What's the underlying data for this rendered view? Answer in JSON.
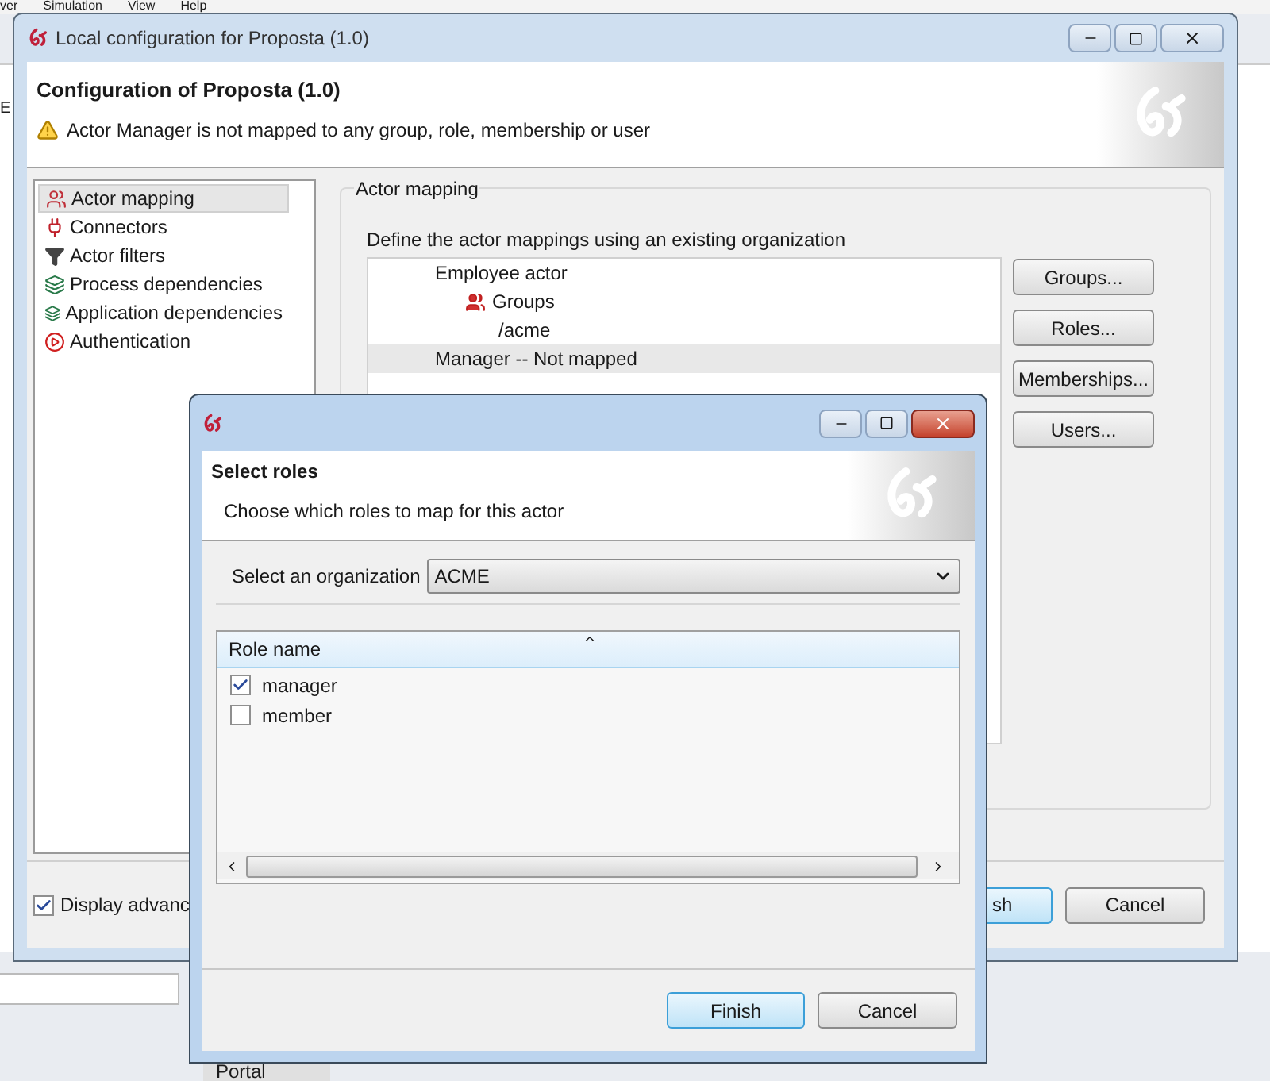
{
  "background_app": {
    "menu": [
      "ver",
      "Simulation",
      "View",
      "Help"
    ],
    "toolbar_label": "E",
    "tab_label": "Portal"
  },
  "main_window": {
    "title": "Local configuration for Proposta (1.0)",
    "heading": "Configuration of Proposta (1.0)",
    "warning": "Actor Manager is not mapped to any group, role, membership or user",
    "nav": [
      {
        "label": "Actor mapping",
        "kind": "actors",
        "selected": true
      },
      {
        "label": "Connectors",
        "kind": "connector",
        "selected": false
      },
      {
        "label": "Actor filters",
        "kind": "filter",
        "selected": false
      },
      {
        "label": "Process dependencies",
        "kind": "dependency",
        "selected": false
      },
      {
        "label": "Application dependencies",
        "kind": "dependency",
        "selected": false
      },
      {
        "label": "Authentication",
        "kind": "auth",
        "selected": false
      }
    ],
    "group_title": "Actor mapping",
    "instruction": "Define the actor mappings using an existing organization",
    "mapping_tree": [
      {
        "label": "Employee actor",
        "kind": "actor",
        "selected": false,
        "children": [
          {
            "label": "Groups",
            "kind": "group",
            "selected": false,
            "children": [
              {
                "label": "/acme",
                "kind": "entry",
                "selected": false
              }
            ]
          }
        ]
      },
      {
        "label": "Manager -- Not mapped",
        "kind": "actor",
        "selected": true
      }
    ],
    "side_buttons": [
      "Groups...",
      "Roles...",
      "Memberships...",
      "Users..."
    ],
    "advanced": {
      "label": "Display advanc",
      "checked": true
    },
    "buttons": [
      "sh",
      "Cancel"
    ]
  },
  "dialog": {
    "heading": "Select roles",
    "description": "Choose which roles to map for this actor",
    "org_label": "Select an organization",
    "org_value": "ACME",
    "column": "Role name",
    "roles": [
      {
        "label": "manager",
        "checked": true
      },
      {
        "label": "member",
        "checked": false
      }
    ],
    "buttons": [
      "Finish",
      "Cancel"
    ]
  }
}
